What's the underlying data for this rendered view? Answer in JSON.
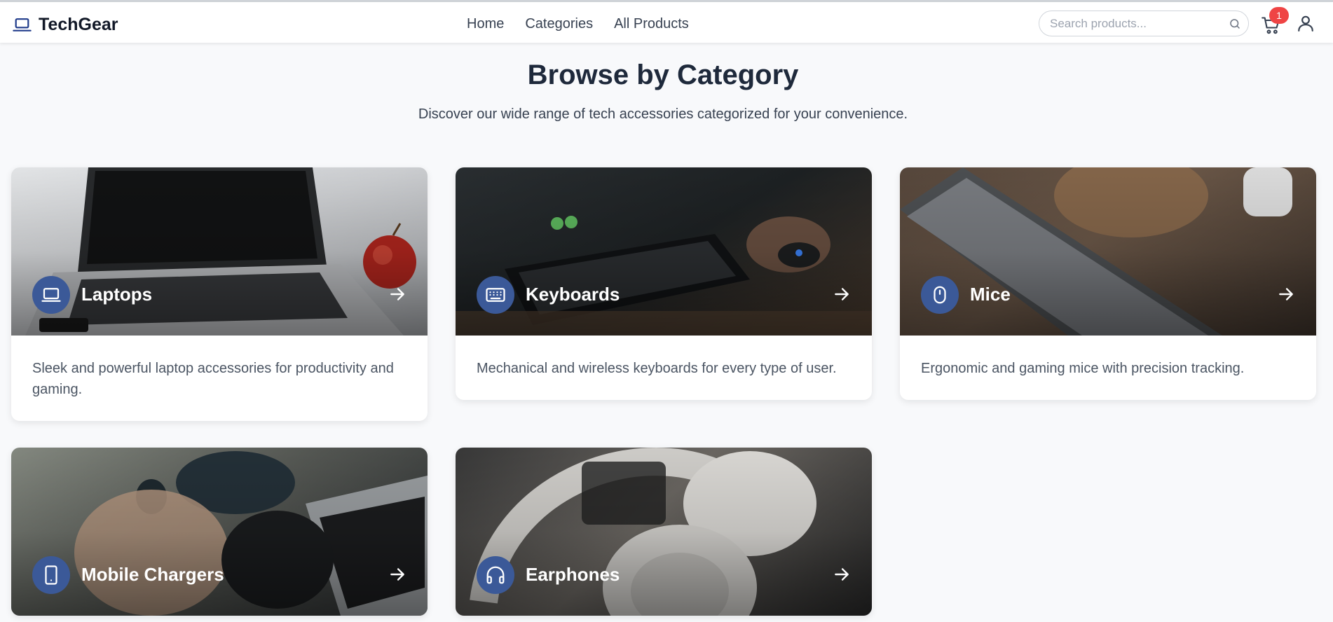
{
  "header": {
    "brand": "TechGear",
    "nav": [
      "Home",
      "Categories",
      "All Products"
    ],
    "search_placeholder": "Search products...",
    "cart_count": "1"
  },
  "hero": {
    "title": "Browse by Category",
    "subtitle": "Discover our wide range of tech accessories categorized for your convenience."
  },
  "categories": [
    {
      "name": "Laptops",
      "icon": "laptop-icon",
      "description": "Sleek and powerful laptop accessories for productivity and gaming."
    },
    {
      "name": "Keyboards",
      "icon": "keyboard-icon",
      "description": "Mechanical and wireless keyboards for every type of user."
    },
    {
      "name": "Mice",
      "icon": "mouse-icon",
      "description": "Ergonomic and gaming mice with precision tracking."
    },
    {
      "name": "Mobile Chargers",
      "icon": "smartphone-icon",
      "description": ""
    },
    {
      "name": "Earphones",
      "icon": "headphones-icon",
      "description": ""
    }
  ],
  "colors": {
    "accent": "#3b5998",
    "badge": "#ef4444"
  }
}
